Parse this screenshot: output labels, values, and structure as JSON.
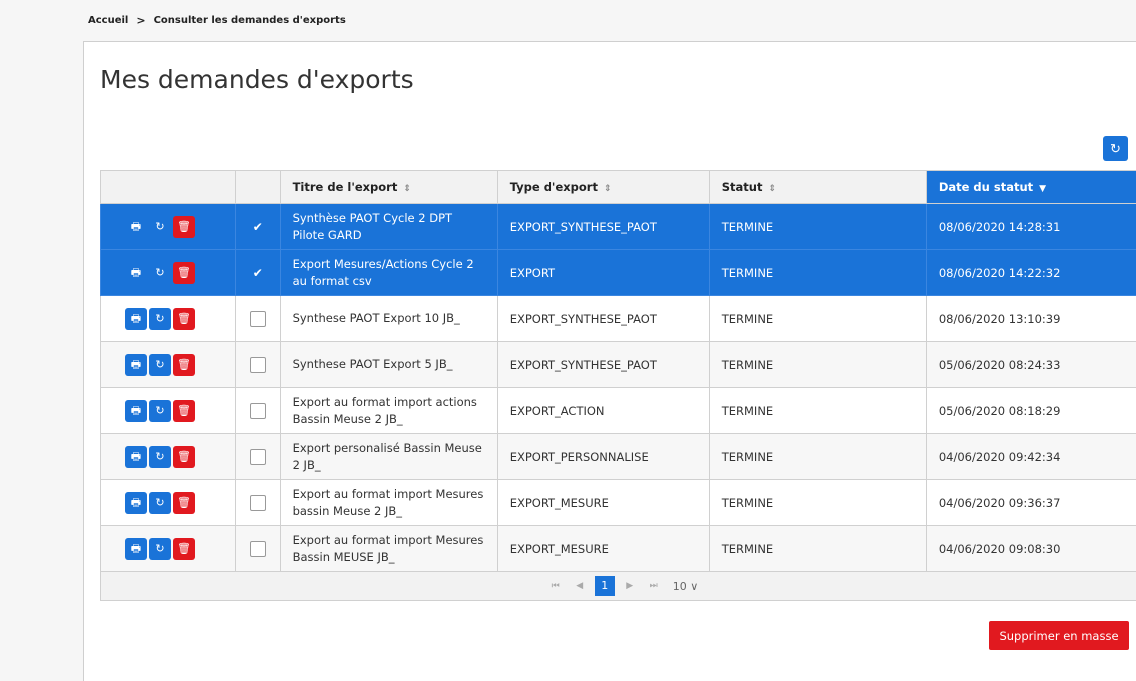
{
  "breadcrumb": {
    "home": "Accueil",
    "separator": ">",
    "current": "Consulter les demandes d'exports"
  },
  "page_title": "Mes demandes d'exports",
  "refresh_icon": "↻",
  "table": {
    "headers": {
      "actions": "",
      "select": "",
      "title": "Titre de l'export",
      "type": "Type d'export",
      "status": "Statut",
      "date": "Date du statut"
    },
    "sort_icon": "⇕",
    "sorted_icon": "▼",
    "icons": {
      "print": "🖶",
      "redo": "↻",
      "delete": "🗑",
      "check": "✔"
    },
    "rows": [
      {
        "title": "Synthèse PAOT Cycle 2 DPT Pilote GARD",
        "type": "EXPORT_SYNTHESE_PAOT",
        "status": "TERMINE",
        "date": "08/06/2020 14:28:31",
        "selected": true
      },
      {
        "title": "Export Mesures/Actions Cycle 2 au format csv",
        "type": "EXPORT",
        "status": "TERMINE",
        "date": "08/06/2020 14:22:32",
        "selected": true
      },
      {
        "title": "Synthese PAOT Export 10 JB_",
        "type": "EXPORT_SYNTHESE_PAOT",
        "status": "TERMINE",
        "date": "08/06/2020 13:10:39",
        "selected": false
      },
      {
        "title": "Synthese PAOT Export 5 JB_",
        "type": "EXPORT_SYNTHESE_PAOT",
        "status": "TERMINE",
        "date": "05/06/2020 08:24:33",
        "selected": false
      },
      {
        "title": "Export au format import actions Bassin Meuse 2 JB_",
        "type": "EXPORT_ACTION",
        "status": "TERMINE",
        "date": "05/06/2020 08:18:29",
        "selected": false
      },
      {
        "title": "Export personalisé Bassin Meuse 2 JB_",
        "type": "EXPORT_PERSONNALISE",
        "status": "TERMINE",
        "date": "04/06/2020 09:42:34",
        "selected": false
      },
      {
        "title": "Export au format import Mesures bassin Meuse 2 JB_",
        "type": "EXPORT_MESURE",
        "status": "TERMINE",
        "date": "04/06/2020 09:36:37",
        "selected": false
      },
      {
        "title": "Export au format import Mesures Bassin MEUSE JB_",
        "type": "EXPORT_MESURE",
        "status": "TERMINE",
        "date": "04/06/2020 09:08:30",
        "selected": false
      }
    ]
  },
  "pagination": {
    "first": "⏮",
    "prev": "◀",
    "current_page": "1",
    "next": "▶",
    "last": "⏭",
    "page_size": "10 ∨"
  },
  "bulk_delete_label": "Supprimer en masse"
}
